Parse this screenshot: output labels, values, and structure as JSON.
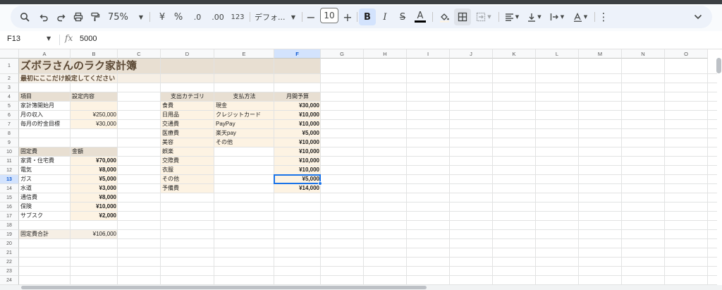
{
  "toolbar": {
    "zoom": "75%",
    "currency": "¥",
    "percent": "%",
    "dec_decrease": ".0",
    "dec_increase": ".00",
    "number_format": "123",
    "font_name": "デフォ...",
    "font_size": "10",
    "bold": "B",
    "italic": "I",
    "strike": "S",
    "text_color": "A",
    "more": "⋮",
    "collapse": "⌄"
  },
  "formula_bar": {
    "name_box": "F13",
    "fx": "fx",
    "value": "5000"
  },
  "columns": [
    "A",
    "B",
    "C",
    "D",
    "E",
    "F",
    "G",
    "H",
    "I",
    "J",
    "K",
    "L",
    "M",
    "N",
    "O"
  ],
  "rows": [
    "1",
    "2",
    "3",
    "4",
    "5",
    "6",
    "7",
    "8",
    "9",
    "10",
    "11",
    "12",
    "13",
    "14",
    "15",
    "16",
    "17",
    "18",
    "19",
    "20",
    "21",
    "22",
    "23",
    "24"
  ],
  "selected_cell": {
    "col": "F",
    "row": "13"
  },
  "sheet": {
    "title": "ズボラさんのラク家計簿",
    "subtitle": "最初にここだけ設定してください",
    "settings": {
      "header_item": "項目",
      "header_value": "設定内容",
      "rows": [
        {
          "label": "家計簿開始月",
          "value": ""
        },
        {
          "label": "月の収入",
          "value": "¥250,000"
        },
        {
          "label": "毎月の貯金目標",
          "value": "¥30,000"
        }
      ]
    },
    "fixed": {
      "header_item": "固定費",
      "header_value": "金額",
      "rows": [
        {
          "label": "家賃・住宅費",
          "value": "¥70,000"
        },
        {
          "label": "電気",
          "value": "¥8,000"
        },
        {
          "label": "ガス",
          "value": "¥5,000"
        },
        {
          "label": "水道",
          "value": "¥3,000"
        },
        {
          "label": "通信費",
          "value": "¥8,000"
        },
        {
          "label": "保険",
          "value": "¥10,000"
        },
        {
          "label": "サブスク",
          "value": "¥2,000"
        }
      ],
      "total_label": "固定費合計",
      "total_value": "¥106,000"
    },
    "budget": {
      "header_category": "支出カテゴリ",
      "header_payment": "支払方法",
      "header_budget": "月間予算",
      "rows": [
        {
          "category": "食費",
          "payment": "現金",
          "budget": "¥30,000"
        },
        {
          "category": "日用品",
          "payment": "クレジットカード",
          "budget": "¥10,000"
        },
        {
          "category": "交通費",
          "payment": "PayPay",
          "budget": "¥10,000"
        },
        {
          "category": "医療費",
          "payment": "楽天pay",
          "budget": "¥5,000"
        },
        {
          "category": "美容",
          "payment": "その他",
          "budget": "¥10,000"
        },
        {
          "category": "娯楽",
          "payment": "",
          "budget": "¥10,000"
        },
        {
          "category": "交際費",
          "payment": "",
          "budget": "¥10,000"
        },
        {
          "category": "衣服",
          "payment": "",
          "budget": "¥10,000"
        },
        {
          "category": "その他",
          "payment": "",
          "budget": "¥5,000"
        },
        {
          "category": "予備費",
          "payment": "",
          "budget": "¥14,000"
        }
      ]
    }
  }
}
